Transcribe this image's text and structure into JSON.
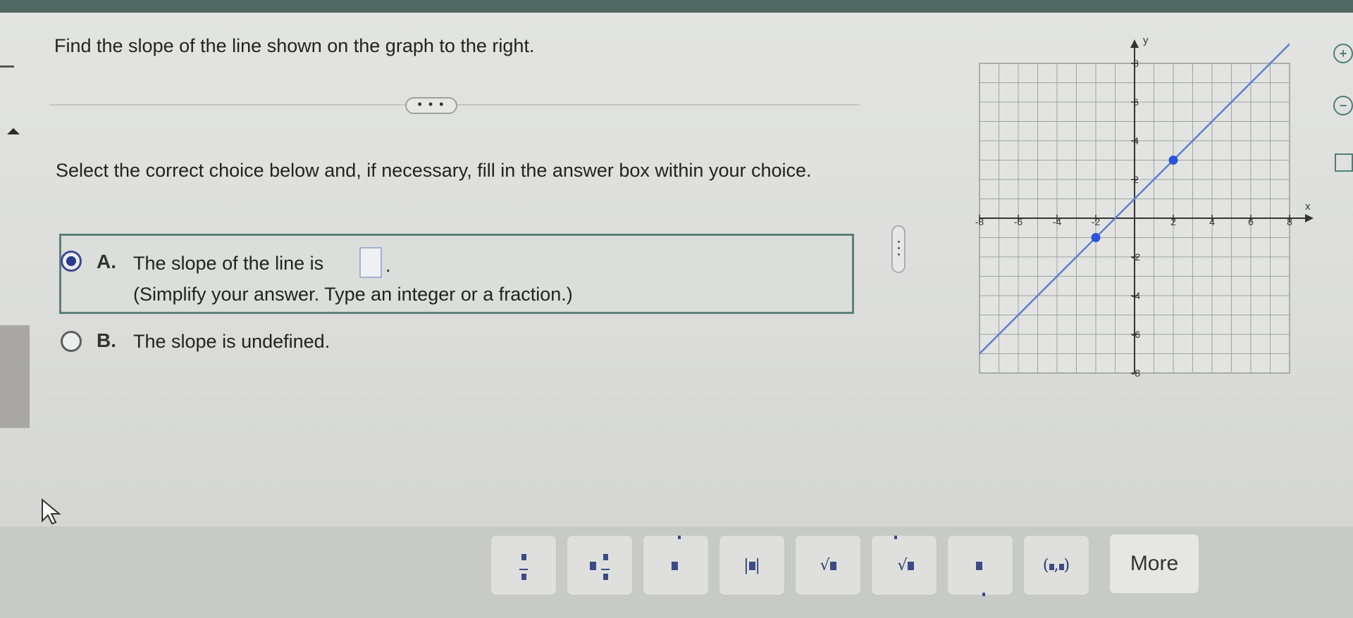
{
  "question": "Find the slope of the line shown on the graph to the right.",
  "more_pill": "• • •",
  "instruction": "Select the correct choice below and, if necessary, fill in the answer box within your choice.",
  "choices": [
    {
      "letter": "A.",
      "text": "The slope of the line is",
      "hint": "(Simplify your answer. Type an integer or a fraction.)",
      "selected": true
    },
    {
      "letter": "B.",
      "text": "The slope is undefined.",
      "selected": false
    }
  ],
  "answer_value": "",
  "answer_suffix": ".",
  "chart_data": {
    "type": "line",
    "xlabel": "x",
    "ylabel": "y",
    "xlim": [
      -8,
      8
    ],
    "ylim": [
      -8,
      8
    ],
    "grid": true,
    "x_ticks": [
      "-8",
      "-6",
      "-4",
      "-2",
      "2",
      "4",
      "6",
      "8"
    ],
    "y_ticks": [
      "8",
      "6",
      "4",
      "2",
      "-2",
      "-4",
      "-6",
      "-8"
    ],
    "series": [
      {
        "x": [
          -10,
          8.5
        ],
        "y": [
          -9,
          9.5
        ],
        "color": "#5b7fcf"
      }
    ],
    "points": [
      {
        "x": -2,
        "y": -1,
        "color": "#2a55d8"
      },
      {
        "x": 2,
        "y": 3,
        "color": "#2a55d8"
      }
    ]
  },
  "toolbar": {
    "buttons": [
      "fraction",
      "mixed-number",
      "exponent",
      "absolute-value",
      "square-root",
      "nth-root",
      "subscript",
      "ordered-pair"
    ],
    "more_label": "More"
  },
  "colors": {
    "accent": "#2c3a8c",
    "frame": "#5b7f7c",
    "line": "#5b7fcf",
    "point": "#2a55d8"
  }
}
